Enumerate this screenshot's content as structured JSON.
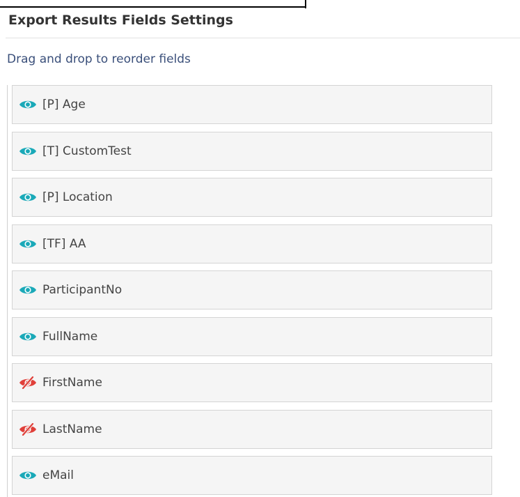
{
  "panel": {
    "title": "Export Results Fields Settings",
    "hint": "Drag and drop to reorder fields"
  },
  "colors": {
    "visible_icon": "#1aa9b8",
    "hidden_icon": "#e0403a",
    "hint_text": "#3a4f7a"
  },
  "fields": [
    {
      "label": "[P] Age",
      "visible": true,
      "icon": "eye-icon"
    },
    {
      "label": "[T] CustomTest",
      "visible": true,
      "icon": "eye-icon"
    },
    {
      "label": "[P] Location",
      "visible": true,
      "icon": "eye-icon"
    },
    {
      "label": "[TF] AA",
      "visible": true,
      "icon": "eye-icon"
    },
    {
      "label": "ParticipantNo",
      "visible": true,
      "icon": "eye-icon"
    },
    {
      "label": "FullName",
      "visible": true,
      "icon": "eye-icon"
    },
    {
      "label": "FirstName",
      "visible": false,
      "icon": "eye-slash-icon"
    },
    {
      "label": "LastName",
      "visible": false,
      "icon": "eye-slash-icon"
    },
    {
      "label": "eMail",
      "visible": true,
      "icon": "eye-icon"
    }
  ]
}
